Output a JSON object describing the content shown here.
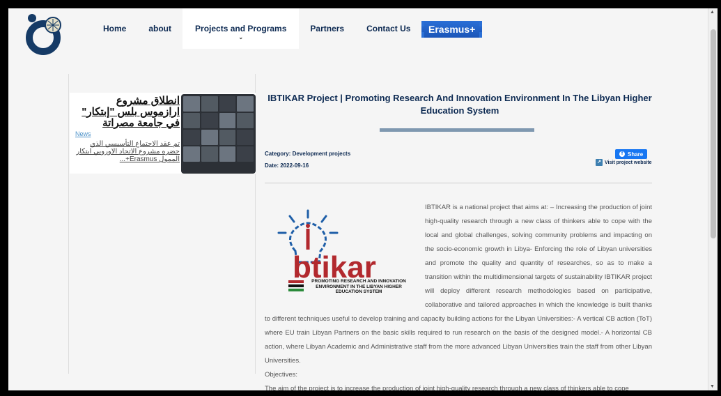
{
  "nav": {
    "home": "Home",
    "about": "about",
    "projects": "Projects and Programs",
    "partners": "Partners",
    "contact": "Contact Us",
    "erasmus": "Erasmus+"
  },
  "news": {
    "title": "انطلاق مشروع ارازموس بلس \"إبتكار\" في جامعة مصراتة",
    "category": "News",
    "excerpt": "تم عقد الاجتماع التأسيسي الذي حضره مشروع الاتحاد الاوروبي ابتكار الممول Erasmus+..."
  },
  "article": {
    "title": "IBTIKAR Project | Promoting Research And Innovation Environment In The Libyan Higher Education System",
    "category": "Category: Development projects",
    "date": "Date: 2022-09-16",
    "share": "Share",
    "visit": "Visit project website",
    "paragraph1": "IBTIKAR is a national project that aims at: – Increasing the production of joint high-quality research through a new class of thinkers able to cope with the local and global challenges, solving community problems and impacting on the socio-economic growth in Libya- Enforcing the role of Libyan universities and promote the quality and quantity of researches, so as to make a transition within the multidimensional targets of sustainability IBTIKAR project will deploy different research methodologies based on participative, collaborative and tailored approaches in which the knowledge is built thanks to different techniques useful to develop training and capacity building actions for the Libyan Universities:- A vertical CB action (ToT) where EU train Libyan Partners on the basic skills required to run research on the basis of the designed model.- A horizontal CB action, where Libyan Academic and Administrative staff from the more advanced Libyan Universities train the staff from other Libyan Universities.",
    "objectives_label": "Objectives:",
    "paragraph2": "The aim of the project is to increase the production of joint high-quality research through a new class of thinkers able to cope"
  },
  "logo": {
    "brand_text": "btikar",
    "tagline": "PROMOTING RESEARCH AND INNOVATION ENVIRONMENT IN THE LIBYAN HIGHER EDUCATION SYSTEM"
  },
  "colors": {
    "navy": "#0d2a52",
    "accent_red": "#b2292e",
    "logo_blue": "#1f5fa8",
    "share_blue": "#1877f2"
  }
}
